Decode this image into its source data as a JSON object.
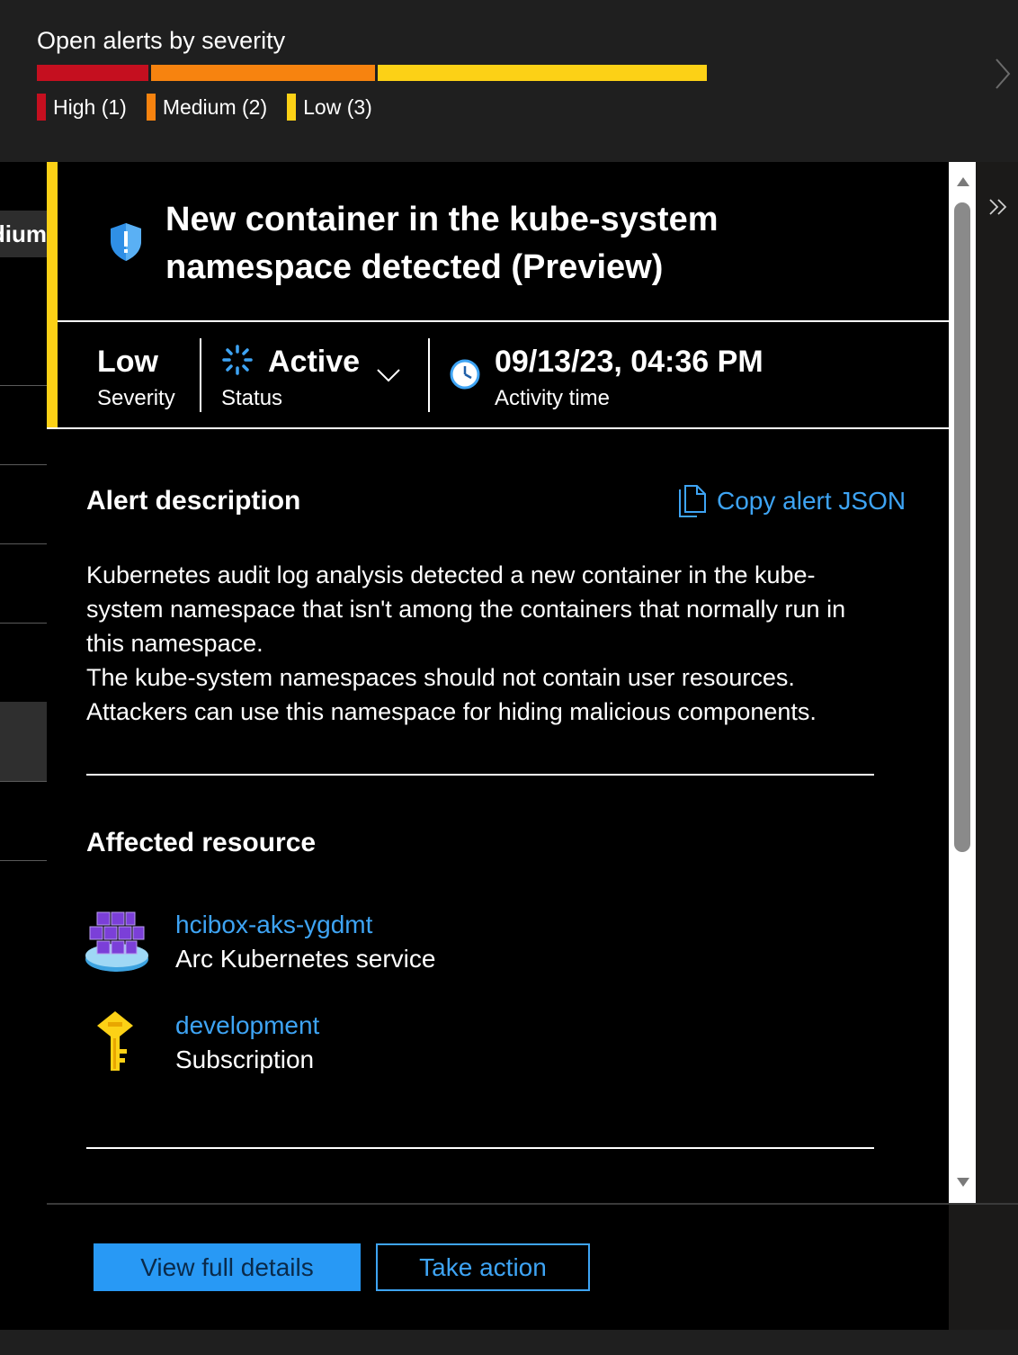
{
  "summary": {
    "title": "Open alerts by severity",
    "bar": [
      {
        "level": "high",
        "count": 1,
        "color": "#c50f1f"
      },
      {
        "level": "medium",
        "count": 2,
        "color": "#f7830f"
      },
      {
        "level": "low",
        "count": 3,
        "color": "#fcd116"
      }
    ],
    "legend": {
      "high": "High (1)",
      "medium": "Medium (2)",
      "low": "Low (3)"
    }
  },
  "peek": {
    "tab_text": "dium"
  },
  "alert": {
    "title": "New container in the kube-system namespace detected (Preview)",
    "severity_value": "Low",
    "severity_label": "Severity",
    "status_value": "Active",
    "status_label": "Status",
    "time_value": "09/13/23, 04:36 PM",
    "time_label": "Activity time",
    "accent_color": "#fcd116"
  },
  "description": {
    "heading": "Alert description",
    "copy_label": "Copy alert JSON",
    "line1": "Kubernetes audit log analysis detected a new container in the kube-",
    "line2": "system namespace that isn't among the containers that normally run in",
    "line3": "this namespace.",
    "line4": "The kube-system namespaces should not contain user resources.",
    "line5": "Attackers can use this namespace for hiding malicious components."
  },
  "affected": {
    "heading": "Affected resource",
    "resources": [
      {
        "name": "hcibox-aks-ygdmt",
        "type": "Arc Kubernetes service",
        "icon": "kubernetes-cluster-icon"
      },
      {
        "name": "development",
        "type": "Subscription",
        "icon": "subscription-key-icon"
      }
    ]
  },
  "actions": {
    "primary": "View full details",
    "secondary": "Take action"
  }
}
